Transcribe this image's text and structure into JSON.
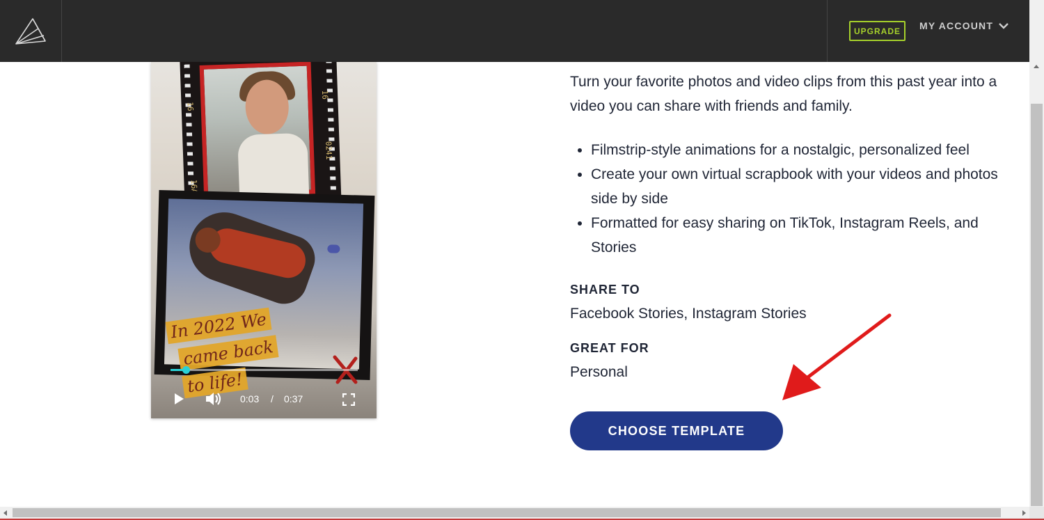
{
  "nav": {
    "upgrade_label": "UPGRADE",
    "account_label": "MY ACCOUNT",
    "accent_color": "#a6d12b"
  },
  "video": {
    "caption_lines": [
      "In 2022 We",
      "came back",
      "to life!"
    ],
    "film_numbers": [
      "16",
      "16",
      "0241",
      "16A"
    ],
    "current_time": "0:03",
    "separator": "/",
    "duration": "0:37",
    "progress_fraction": 0.08
  },
  "content": {
    "intro": "Turn your favorite photos and video clips from this past year into a video you can share with friends and family.",
    "features": [
      "Filmstrip-style animations for a nostalgic, personalized feel",
      "Create your own virtual scrapbook with your videos and photos side by side",
      "Formatted for easy sharing on TikTok, Instagram Reels, and Stories"
    ],
    "share_label": "SHARE TO",
    "share_value": "Facebook Stories, Instagram Stories",
    "great_label": "GREAT FOR",
    "great_value": "Personal",
    "cta_label": "CHOOSE TEMPLATE",
    "cta_color": "#22398a",
    "annotation_arrow_color": "#e01b1b"
  }
}
